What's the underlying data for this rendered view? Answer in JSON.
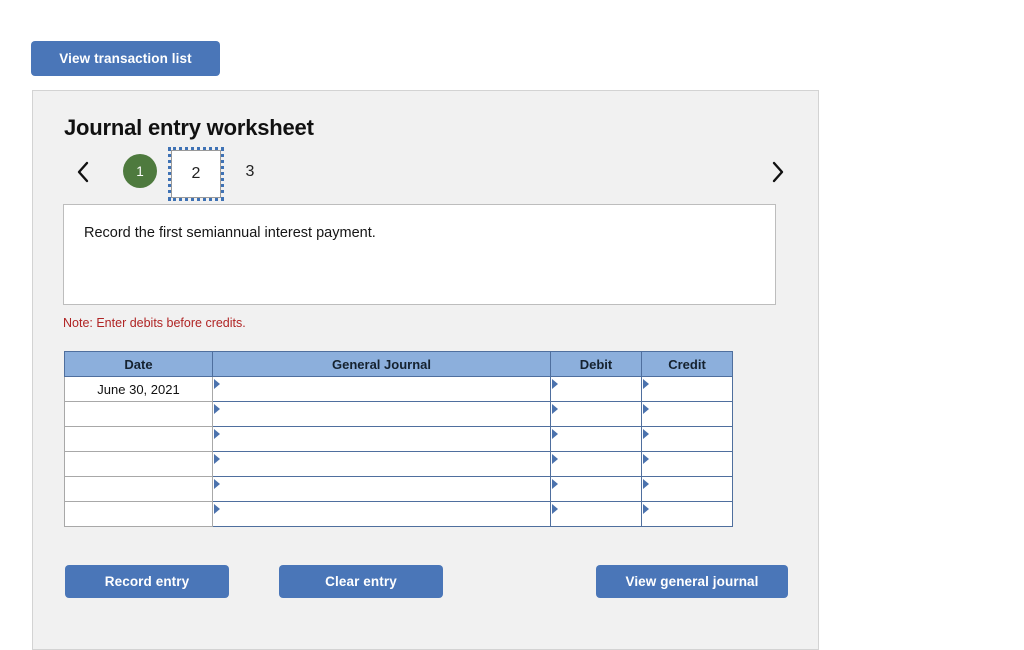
{
  "toolbar": {
    "view_transaction_list_label": "View transaction list"
  },
  "worksheet": {
    "title": "Journal entry worksheet",
    "pager": {
      "prev_icon": "chevron-left-icon",
      "next_icon": "chevron-right-icon",
      "tabs": [
        {
          "label": "1",
          "state": "done"
        },
        {
          "label": "2",
          "state": "current"
        },
        {
          "label": "3",
          "state": "plain"
        }
      ]
    },
    "instruction": "Record the first semiannual interest payment.",
    "note": "Note: Enter debits before credits.",
    "table": {
      "headers": [
        "Date",
        "General Journal",
        "Debit",
        "Credit"
      ],
      "rows": [
        {
          "date": "June 30, 2021",
          "general_journal": "",
          "debit": "",
          "credit": ""
        },
        {
          "date": "",
          "general_journal": "",
          "debit": "",
          "credit": ""
        },
        {
          "date": "",
          "general_journal": "",
          "debit": "",
          "credit": ""
        },
        {
          "date": "",
          "general_journal": "",
          "debit": "",
          "credit": ""
        },
        {
          "date": "",
          "general_journal": "",
          "debit": "",
          "credit": ""
        },
        {
          "date": "",
          "general_journal": "",
          "debit": "",
          "credit": ""
        }
      ]
    },
    "actions": {
      "record_entry_label": "Record entry",
      "clear_entry_label": "Clear entry",
      "view_general_journal_label": "View general journal"
    }
  },
  "colors": {
    "button_blue": "#4a76b8",
    "tab_green": "#4e7a3e",
    "header_blue": "#8cafdc",
    "note_red": "#b02424",
    "panel_gray": "#f1f1f1"
  }
}
